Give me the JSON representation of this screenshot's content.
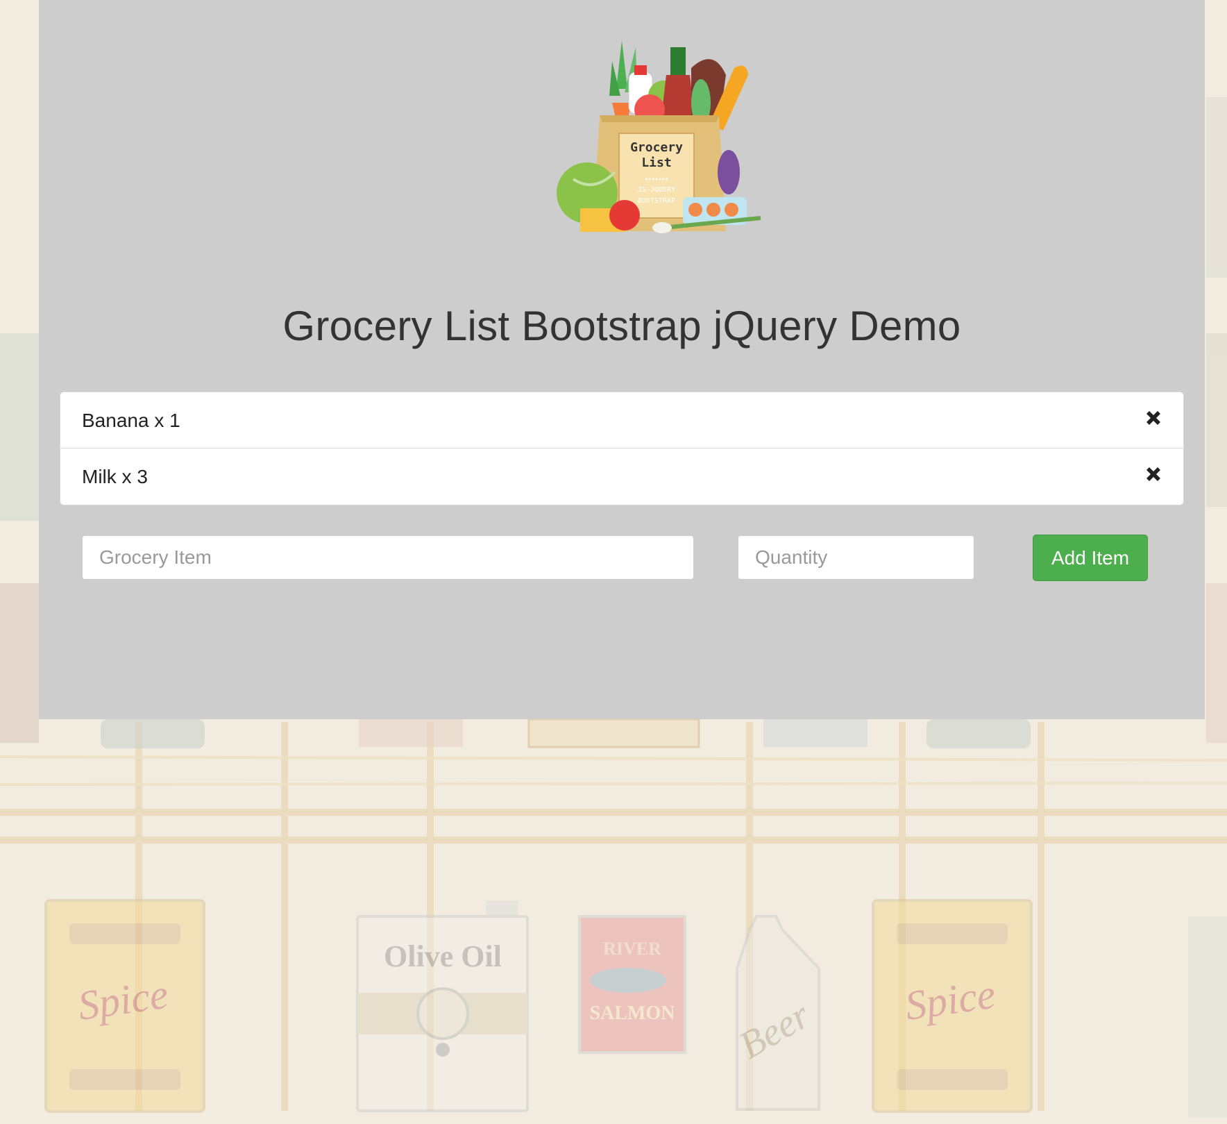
{
  "background": {
    "cans": [
      "Spice",
      "Olive Oil",
      "RIVER",
      "SALMON",
      "Beer",
      "Spice"
    ],
    "colors": {
      "wall": "#f1ecdf",
      "wood": "#ead9b8"
    }
  },
  "logo": {
    "icon": "grocery-bag-icon",
    "title_line1": "Grocery",
    "title_line2": "List",
    "stars": "★★★★★★★",
    "subtitle_line1": "JS-JQUERY",
    "subtitle_line2": "BOOTSTRAP"
  },
  "header": {
    "title": "Grocery List Bootstrap jQuery Demo"
  },
  "list": {
    "items": [
      {
        "text": "Banana x 1",
        "remove_icon": "close-icon"
      },
      {
        "text": "Milk x 3",
        "remove_icon": "close-icon"
      }
    ]
  },
  "form": {
    "item_placeholder": "Grocery Item",
    "item_value": "",
    "quantity_placeholder": "Quantity",
    "quantity_value": "",
    "add_label": "Add Item"
  },
  "colors": {
    "panel": "#cdcdcd",
    "button": "#4cae4c",
    "text": "#333333"
  }
}
